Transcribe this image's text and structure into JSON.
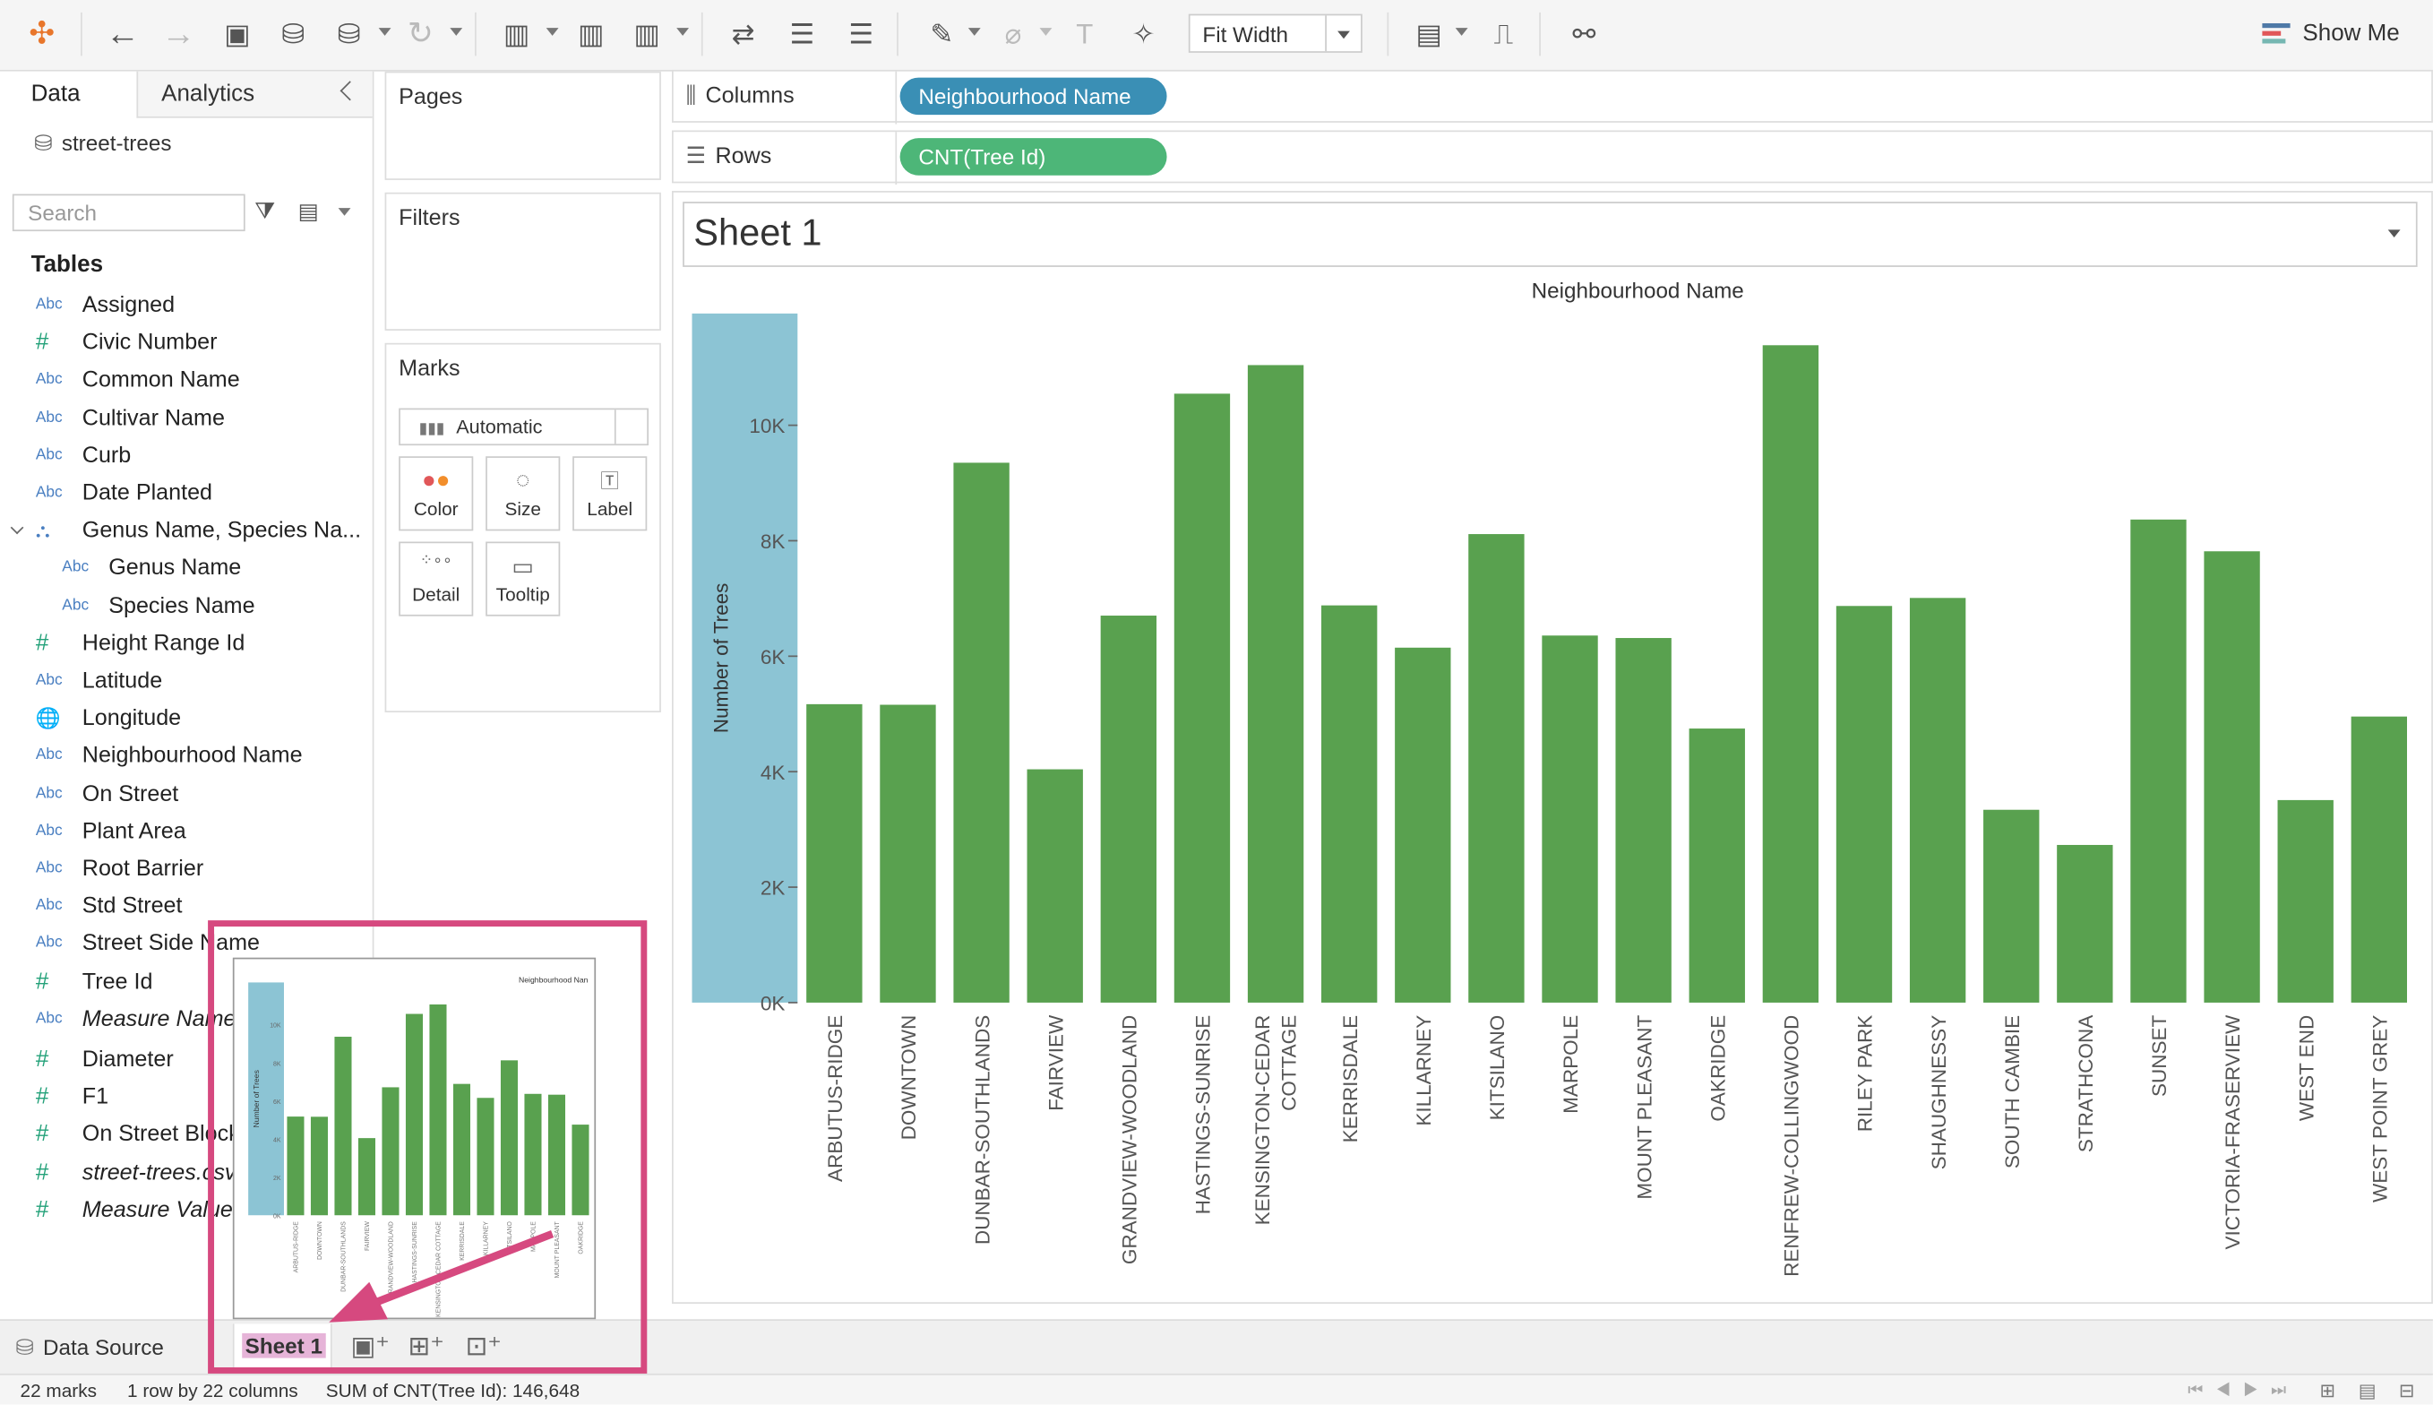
{
  "toolbar": {
    "fit_label": "Fit Width",
    "show_me_label": "Show Me"
  },
  "data_pane": {
    "tab_data": "Data",
    "tab_analytics": "Analytics",
    "datasource": "street-trees",
    "search_placeholder": "Search",
    "tables_heading": "Tables",
    "fields": [
      {
        "type": "Abc",
        "name": "Assigned"
      },
      {
        "type": "#",
        "name": "Civic Number"
      },
      {
        "type": "Abc",
        "name": "Common Name"
      },
      {
        "type": "Abc",
        "name": "Cultivar Name"
      },
      {
        "type": "Abc",
        "name": "Curb"
      },
      {
        "type": "Abc",
        "name": "Date Planted"
      },
      {
        "type": "hier",
        "name": "Genus Name, Species Na..."
      },
      {
        "type": "Abc",
        "name": "Genus Name",
        "indent": true
      },
      {
        "type": "Abc",
        "name": "Species Name",
        "indent": true
      },
      {
        "type": "#",
        "name": "Height Range Id"
      },
      {
        "type": "Abc",
        "name": "Latitude"
      },
      {
        "type": "geo",
        "name": "Longitude"
      },
      {
        "type": "Abc",
        "name": "Neighbourhood Name"
      },
      {
        "type": "Abc",
        "name": "On Street"
      },
      {
        "type": "Abc",
        "name": "Plant Area"
      },
      {
        "type": "Abc",
        "name": "Root Barrier"
      },
      {
        "type": "Abc",
        "name": "Std Street"
      },
      {
        "type": "Abc",
        "name": "Street Side Name"
      },
      {
        "type": "#",
        "name": "Tree Id"
      },
      {
        "type": "Abc",
        "name": "Measure Names",
        "italic": true
      },
      {
        "type": "#",
        "name": "Diameter"
      },
      {
        "type": "#",
        "name": "F1"
      },
      {
        "type": "#",
        "name": "On Street Block"
      },
      {
        "type": "#",
        "name": "street-trees.csv",
        "italic": true
      },
      {
        "type": "#",
        "name": "Measure Values",
        "italic": true
      }
    ]
  },
  "shelves": {
    "pages": "Pages",
    "filters": "Filters",
    "marks": "Marks",
    "mark_type": "Automatic",
    "mark_buttons": [
      "Color",
      "Size",
      "Label",
      "Detail",
      "Tooltip"
    ],
    "columns_label": "Columns",
    "columns_pill": "Neighbourhood Name",
    "rows_label": "Rows",
    "rows_pill": "CNT(Tree Id)"
  },
  "sheet_title": "Sheet 1",
  "chart_data": {
    "type": "bar",
    "title": "Neighbourhood Name",
    "ylabel": "Number of Trees",
    "ylim": [
      0,
      12000
    ],
    "yticks": [
      "0K",
      "2K",
      "4K",
      "6K",
      "8K",
      "10K"
    ],
    "categories": [
      "ARBUTUS-RIDGE",
      "DOWNTOWN",
      "DUNBAR-SOUTHLANDS",
      "FAIRVIEW",
      "GRANDVIEW-WOODLAND",
      "HASTINGS-SUNRISE",
      "KENSINGTON-CEDAR COTTAGE",
      "KERRISDALE",
      "KILLARNEY",
      "KITSILANO",
      "MARPOLE",
      "MOUNT PLEASANT",
      "OAKRIDGE",
      "RENFREW-COLLINGWOOD",
      "RILEY PARK",
      "SHAUGHNESSY",
      "SOUTH CAMBIE",
      "STRATHCONA",
      "SUNSET",
      "VICTORIA-FRASERVIEW",
      "WEST END",
      "WEST POINT GREY"
    ],
    "values": [
      5169,
      5159,
      9351,
      4041,
      6703,
      10547,
      11042,
      6880,
      6148,
      8115,
      6358,
      6315,
      4747,
      11386,
      6870,
      7009,
      3340,
      2731,
      8367,
      7817,
      3508,
      4955
    ],
    "bar_color": "#59a14f",
    "highlight_color": "#8cc4d4"
  },
  "thumbnail": {
    "title": "Neighbourhood Nan",
    "ylabel": "Number of Trees"
  },
  "bottom": {
    "data_source": "Data Source",
    "sheet_tab": "Sheet 1"
  },
  "status": {
    "marks": "22 marks",
    "dims": "1 row by 22 columns",
    "sum": "SUM of CNT(Tree Id): 146,648"
  },
  "colors": {
    "pill_blue": "#3a8fb5",
    "pill_green": "#4db678",
    "accent": "#d6497f"
  }
}
